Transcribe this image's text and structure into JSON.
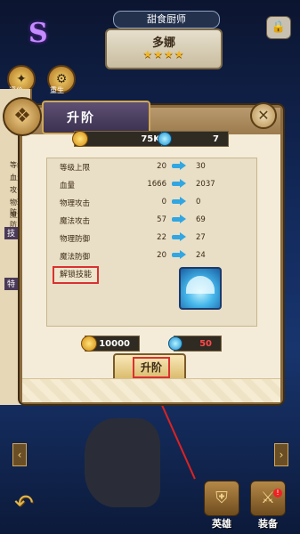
{
  "game": {
    "rank_letter": "S",
    "hero_title": "甜食厨师",
    "hero_name": "多娜",
    "stars": "★★★★",
    "side_tabs": [
      "评价",
      "重生"
    ],
    "left_panel_labels": [
      "等级",
      "血量",
      "攻击",
      "物理防",
      "魔法防"
    ],
    "left_panel_tabs": [
      "技",
      "特"
    ],
    "bottom_nav": [
      {
        "label": "英雄",
        "icon": "helmet-icon"
      },
      {
        "label": "装备",
        "icon": "equipment-icon",
        "badge": "!"
      }
    ]
  },
  "dialog": {
    "title": "升阶",
    "resources": {
      "gold": "75K",
      "gems": "7"
    },
    "stats": [
      {
        "name": "等级上限",
        "current": "20",
        "next": "30"
      },
      {
        "name": "血量",
        "current": "1666",
        "next": "2037"
      },
      {
        "name": "物理攻击",
        "current": "0",
        "next": "0"
      },
      {
        "name": "魔法攻击",
        "current": "57",
        "next": "69"
      },
      {
        "name": "物理防御",
        "current": "22",
        "next": "27"
      },
      {
        "name": "魔法防御",
        "current": "20",
        "next": "24"
      }
    ],
    "unlock_skill_label": "解锁技能",
    "cost": {
      "gold": "10000",
      "gems": "50"
    },
    "upgrade_button": "升阶"
  },
  "colors": {
    "accent_red": "#d93131",
    "arrow_blue": "#31a6e2",
    "panel_border": "#8a6a3c"
  }
}
